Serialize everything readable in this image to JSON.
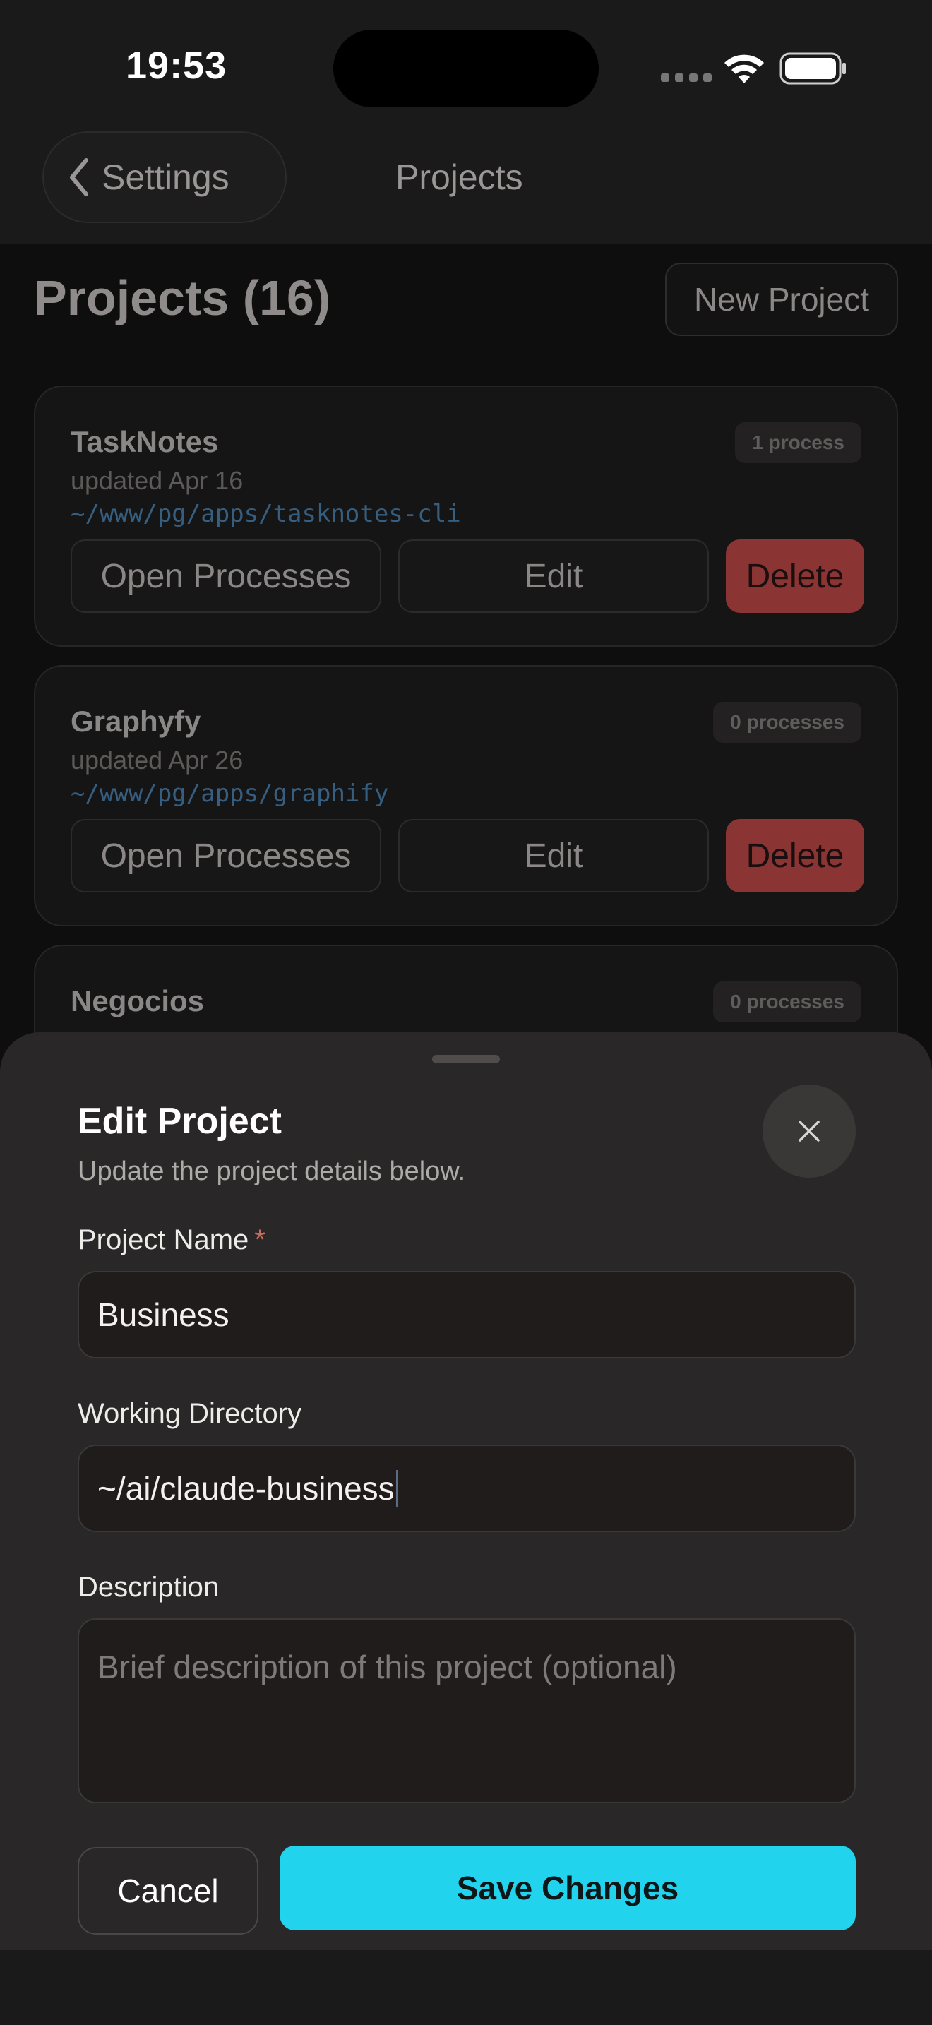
{
  "status_bar": {
    "time": "19:53"
  },
  "nav": {
    "back_label": "Settings",
    "title": "Projects"
  },
  "content": {
    "title": "Projects (16)",
    "new_project_label": "New Project",
    "projects": [
      {
        "name": "TaskNotes",
        "updated": "updated Apr 16",
        "path": "~/www/pg/apps/tasknotes-cli",
        "processes": "1 process",
        "open_label": "Open Processes",
        "edit_label": "Edit",
        "delete_label": "Delete"
      },
      {
        "name": "Graphyfy",
        "updated": "updated Apr 26",
        "path": "~/www/pg/apps/graphify",
        "processes": "0 processes",
        "open_label": "Open Processes",
        "edit_label": "Edit",
        "delete_label": "Delete"
      },
      {
        "name": "Negocios",
        "processes": "0 processes"
      }
    ]
  },
  "sheet": {
    "title": "Edit Project",
    "subtitle": "Update the project details below.",
    "name_label": "Project Name",
    "required_mark": "*",
    "name_value": "Business",
    "dir_label": "Working Directory",
    "dir_value": "~/ai/claude-business",
    "desc_label": "Description",
    "desc_placeholder": "Brief description of this project (optional)",
    "cancel_label": "Cancel",
    "save_label": "Save Changes"
  },
  "colors": {
    "accent": "#22d3ee",
    "delete": "#8a3534",
    "path": "#365e80"
  },
  "icons": [
    "chevron-left-icon",
    "wifi-icon",
    "battery-icon",
    "signal-icon",
    "close-icon"
  ]
}
